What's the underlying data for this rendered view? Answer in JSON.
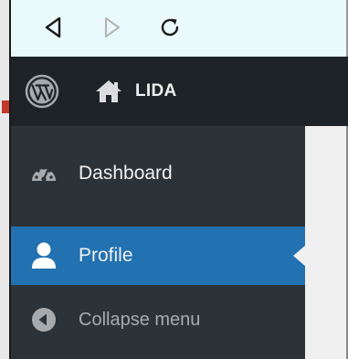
{
  "browser": {
    "back_icon": "back-triangle-icon",
    "forward_icon": "forward-triangle-icon",
    "reload_icon": "reload-icon"
  },
  "admin_bar": {
    "logo_icon": "wordpress-logo-icon",
    "home_icon": "home-icon",
    "site_name": "LIDA"
  },
  "sidebar": {
    "items": [
      {
        "label": "Dashboard",
        "icon": "dashboard-gauge-icon",
        "active": false
      },
      {
        "label": "Profile",
        "icon": "user-icon",
        "active": true
      },
      {
        "label": "Collapse menu",
        "icon": "collapse-arrow-icon",
        "active": false
      }
    ]
  },
  "colors": {
    "admin_bar_bg": "#1d2327",
    "sidebar_bg": "#2c3338",
    "active_item_bg": "#2271b1",
    "text": "#f0f0f1",
    "muted_text": "#a7aaad",
    "content_bg": "#f0f0f1",
    "browser_bar_bg": "#eaf9fc"
  }
}
